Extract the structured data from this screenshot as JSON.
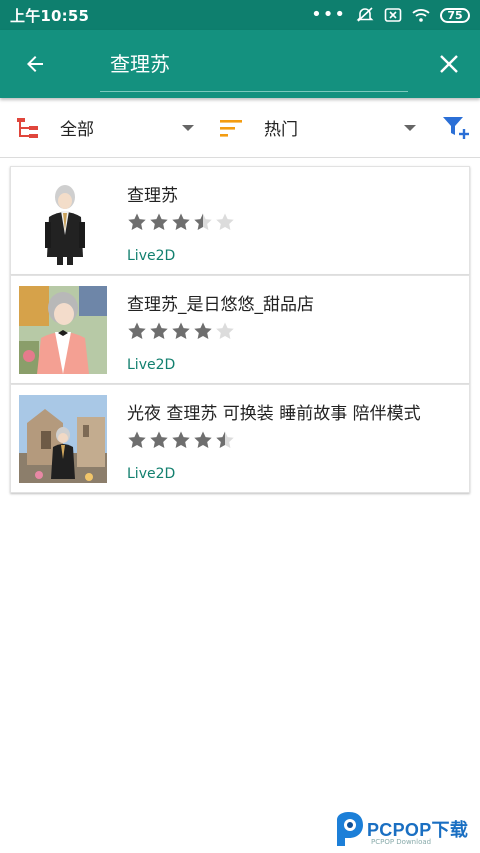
{
  "status_bar": {
    "time": "上午10:55",
    "battery": "75",
    "icons": [
      "dots-icon",
      "alarm-off-icon",
      "sim-icon",
      "wifi-icon",
      "battery-icon"
    ]
  },
  "header": {
    "back_icon": "arrow-left-icon",
    "search_value": "查理苏",
    "clear_icon": "close-icon",
    "color": "#14917f"
  },
  "filters": {
    "category_label": "全部",
    "sort_label": "热门",
    "category_icon": "tree-icon",
    "sort_icon": "sort-icon",
    "filter_add_icon": "filter-add-icon"
  },
  "results": [
    {
      "title": "查理苏",
      "rating": 3.5,
      "tag": "Live2D"
    },
    {
      "title": "查理苏_是日悠悠_甜品店",
      "rating": 4,
      "tag": "Live2D"
    },
    {
      "title": "光夜 查理苏 可换装 睡前故事 陪伴模式",
      "rating": 4.5,
      "tag": "Live2D"
    }
  ],
  "watermark": {
    "text": "PCPOP下载",
    "sub": "PCPOP Download"
  },
  "accent_color": "#13806f"
}
